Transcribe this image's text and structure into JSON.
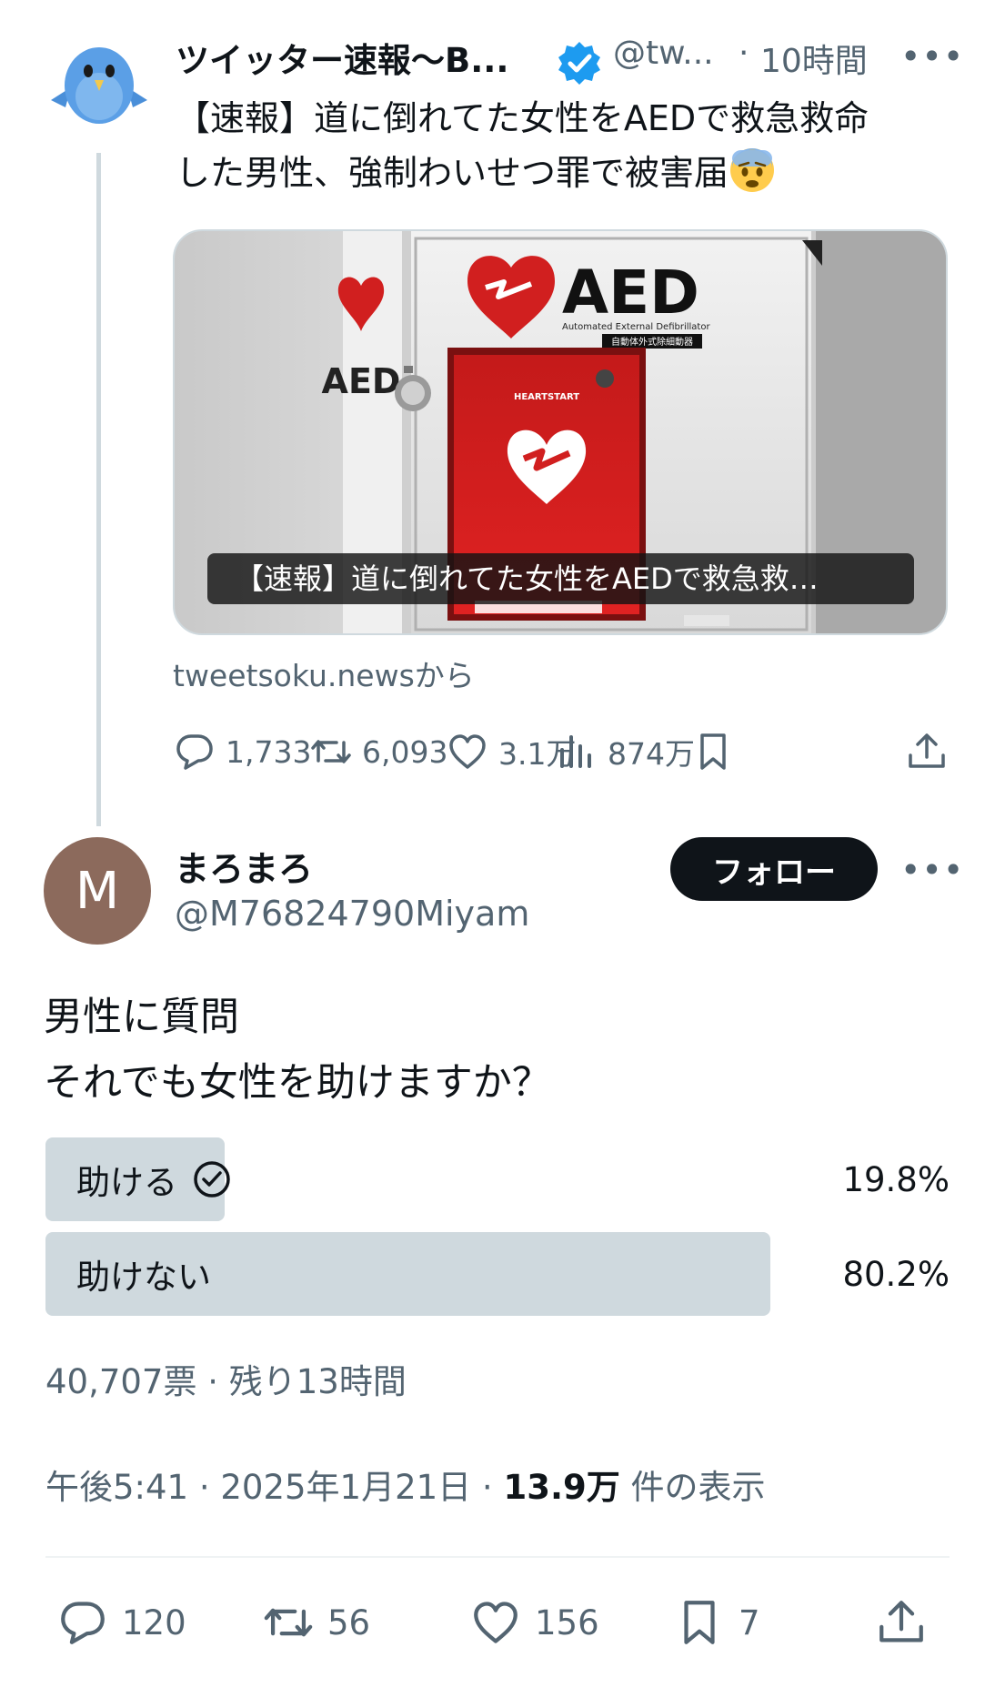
{
  "parent_tweet": {
    "author_name": "ツイッター速報〜B...",
    "handle": "@tw...",
    "separator": "·",
    "time": "10時間",
    "more": "•••",
    "text_line1": "【速報】道に倒れてた女性をAEDで救急救命",
    "text_line2": "した男性、強制わいせつ罪で被害届",
    "card": {
      "caption": "【速報】道に倒れてた女性をAEDで救急救…",
      "image_text_aed": "AED",
      "image_text_sub": "Automated External Defibrillator",
      "image_text_jp": "自動体外式除細動器",
      "image_text_heartstart": "HEARTSTART",
      "image_text_side": "AED"
    },
    "source": "tweetsoku.newsから",
    "actions": {
      "replies": "1,733",
      "retweets": "6,093",
      "likes": "3.1万",
      "views": "874万"
    }
  },
  "main_tweet": {
    "avatar_letter": "M",
    "author_name": "まろまろ",
    "handle": "@M76824790Miyam",
    "follow_label": "フォロー",
    "more": "•••",
    "text_line1": "男性に質問",
    "text_line2": "それでも女性を助けますか？",
    "poll": {
      "options": [
        {
          "label": "助ける",
          "percent": "19.8%",
          "value": 19.8,
          "selected": true
        },
        {
          "label": "助けない",
          "percent": "80.2%",
          "value": 80.2,
          "selected": false
        }
      ],
      "meta": "40,707票 · 残り13時間"
    },
    "timestamp": "午後5:41 · 2025年1月21日 · ",
    "views_count": "13.9万",
    "views_label": " 件の表示",
    "actions": {
      "replies": "120",
      "retweets": "56",
      "likes": "156",
      "bookmarks": "7"
    }
  },
  "colors": {
    "text": "#0f1419",
    "secondary": "#536471",
    "poll_bar": "#cfd9de",
    "verified": "#1d9bf0",
    "follow_bg": "#0f1419"
  }
}
